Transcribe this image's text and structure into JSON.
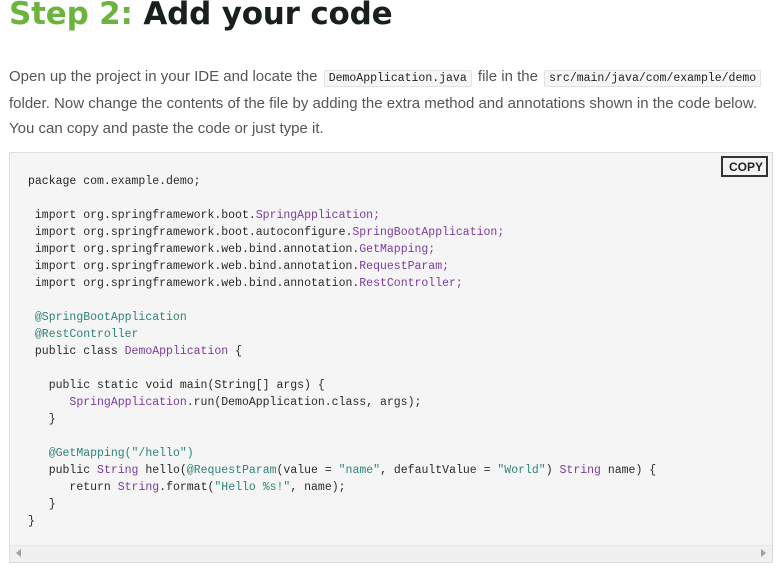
{
  "heading": {
    "step": "Step 2:",
    "title": "Add your code"
  },
  "intro": {
    "part1": "Open up the project in your IDE and locate the",
    "file1": "DemoApplication.java",
    "part2": "file in the",
    "path": "src/main/java/com/example/demo",
    "part3": "folder. Now change the contents of the file by adding the extra method and annotations shown in the code below. You can copy and paste the code or just type it."
  },
  "code": {
    "copy_label": "COPY",
    "package_kw": "package",
    "package_name": "com.example.demo;",
    "imports": [
      {
        "kw": "import",
        "pkg": "org.springframework.boot.",
        "cls": "SpringApplication;"
      },
      {
        "kw": "import",
        "pkg": "org.springframework.boot.autoconfigure.",
        "cls": "SpringBootApplication;"
      },
      {
        "kw": "import",
        "pkg": "org.springframework.web.bind.annotation.",
        "cls": "GetMapping;"
      },
      {
        "kw": "import",
        "pkg": "org.springframework.web.bind.annotation.",
        "cls": "RequestParam;"
      },
      {
        "kw": "import",
        "pkg": "org.springframework.web.bind.annotation.",
        "cls": "RestController;"
      }
    ],
    "ann1": "@SpringBootApplication",
    "ann2": "@RestController",
    "class_decl": "public class",
    "class_name": "DemoApplication",
    "open_brace": "{",
    "main_sig": "public static void main(String[] args) {",
    "run_cls": "SpringApplication",
    "run_rest": ".run(DemoApplication.class, args);",
    "close_inner": "}",
    "getmapping": "@GetMapping(\"/hello\")",
    "hello_sig_a": "public",
    "hello_type": "String",
    "hello_sig_b": "hello(",
    "hello_ann": "@RequestParam",
    "hello_sig_c": "(value = ",
    "hello_str1": "\"name\"",
    "hello_sig_d": ", defaultValue = ",
    "hello_str2": "\"World\"",
    "hello_sig_e": ") ",
    "hello_type2": "String",
    "hello_sig_f": " name) {",
    "return_kw": "return",
    "return_cls": "String",
    "return_rest": ".format(",
    "return_str": "\"Hello %s!\"",
    "return_end": ", name);",
    "close_outer": "}"
  }
}
